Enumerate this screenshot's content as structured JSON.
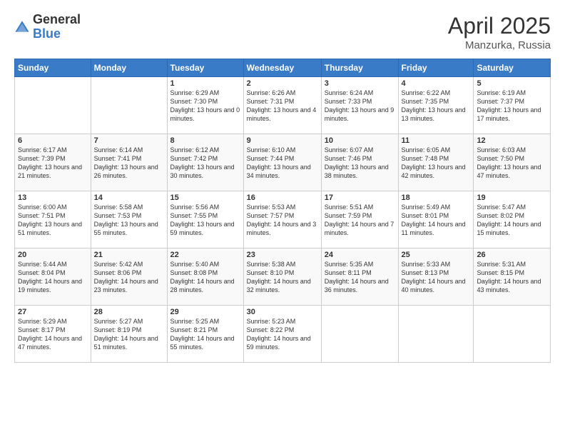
{
  "header": {
    "logo_general": "General",
    "logo_blue": "Blue",
    "title": "April 2025",
    "location": "Manzurka, Russia"
  },
  "days_of_week": [
    "Sunday",
    "Monday",
    "Tuesday",
    "Wednesday",
    "Thursday",
    "Friday",
    "Saturday"
  ],
  "weeks": [
    [
      {
        "day": "",
        "info": ""
      },
      {
        "day": "",
        "info": ""
      },
      {
        "day": "1",
        "info": "Sunrise: 6:29 AM\nSunset: 7:30 PM\nDaylight: 13 hours and 0 minutes."
      },
      {
        "day": "2",
        "info": "Sunrise: 6:26 AM\nSunset: 7:31 PM\nDaylight: 13 hours and 4 minutes."
      },
      {
        "day": "3",
        "info": "Sunrise: 6:24 AM\nSunset: 7:33 PM\nDaylight: 13 hours and 9 minutes."
      },
      {
        "day": "4",
        "info": "Sunrise: 6:22 AM\nSunset: 7:35 PM\nDaylight: 13 hours and 13 minutes."
      },
      {
        "day": "5",
        "info": "Sunrise: 6:19 AM\nSunset: 7:37 PM\nDaylight: 13 hours and 17 minutes."
      }
    ],
    [
      {
        "day": "6",
        "info": "Sunrise: 6:17 AM\nSunset: 7:39 PM\nDaylight: 13 hours and 21 minutes."
      },
      {
        "day": "7",
        "info": "Sunrise: 6:14 AM\nSunset: 7:41 PM\nDaylight: 13 hours and 26 minutes."
      },
      {
        "day": "8",
        "info": "Sunrise: 6:12 AM\nSunset: 7:42 PM\nDaylight: 13 hours and 30 minutes."
      },
      {
        "day": "9",
        "info": "Sunrise: 6:10 AM\nSunset: 7:44 PM\nDaylight: 13 hours and 34 minutes."
      },
      {
        "day": "10",
        "info": "Sunrise: 6:07 AM\nSunset: 7:46 PM\nDaylight: 13 hours and 38 minutes."
      },
      {
        "day": "11",
        "info": "Sunrise: 6:05 AM\nSunset: 7:48 PM\nDaylight: 13 hours and 42 minutes."
      },
      {
        "day": "12",
        "info": "Sunrise: 6:03 AM\nSunset: 7:50 PM\nDaylight: 13 hours and 47 minutes."
      }
    ],
    [
      {
        "day": "13",
        "info": "Sunrise: 6:00 AM\nSunset: 7:51 PM\nDaylight: 13 hours and 51 minutes."
      },
      {
        "day": "14",
        "info": "Sunrise: 5:58 AM\nSunset: 7:53 PM\nDaylight: 13 hours and 55 minutes."
      },
      {
        "day": "15",
        "info": "Sunrise: 5:56 AM\nSunset: 7:55 PM\nDaylight: 13 hours and 59 minutes."
      },
      {
        "day": "16",
        "info": "Sunrise: 5:53 AM\nSunset: 7:57 PM\nDaylight: 14 hours and 3 minutes."
      },
      {
        "day": "17",
        "info": "Sunrise: 5:51 AM\nSunset: 7:59 PM\nDaylight: 14 hours and 7 minutes."
      },
      {
        "day": "18",
        "info": "Sunrise: 5:49 AM\nSunset: 8:01 PM\nDaylight: 14 hours and 11 minutes."
      },
      {
        "day": "19",
        "info": "Sunrise: 5:47 AM\nSunset: 8:02 PM\nDaylight: 14 hours and 15 minutes."
      }
    ],
    [
      {
        "day": "20",
        "info": "Sunrise: 5:44 AM\nSunset: 8:04 PM\nDaylight: 14 hours and 19 minutes."
      },
      {
        "day": "21",
        "info": "Sunrise: 5:42 AM\nSunset: 8:06 PM\nDaylight: 14 hours and 23 minutes."
      },
      {
        "day": "22",
        "info": "Sunrise: 5:40 AM\nSunset: 8:08 PM\nDaylight: 14 hours and 28 minutes."
      },
      {
        "day": "23",
        "info": "Sunrise: 5:38 AM\nSunset: 8:10 PM\nDaylight: 14 hours and 32 minutes."
      },
      {
        "day": "24",
        "info": "Sunrise: 5:35 AM\nSunset: 8:11 PM\nDaylight: 14 hours and 36 minutes."
      },
      {
        "day": "25",
        "info": "Sunrise: 5:33 AM\nSunset: 8:13 PM\nDaylight: 14 hours and 40 minutes."
      },
      {
        "day": "26",
        "info": "Sunrise: 5:31 AM\nSunset: 8:15 PM\nDaylight: 14 hours and 43 minutes."
      }
    ],
    [
      {
        "day": "27",
        "info": "Sunrise: 5:29 AM\nSunset: 8:17 PM\nDaylight: 14 hours and 47 minutes."
      },
      {
        "day": "28",
        "info": "Sunrise: 5:27 AM\nSunset: 8:19 PM\nDaylight: 14 hours and 51 minutes."
      },
      {
        "day": "29",
        "info": "Sunrise: 5:25 AM\nSunset: 8:21 PM\nDaylight: 14 hours and 55 minutes."
      },
      {
        "day": "30",
        "info": "Sunrise: 5:23 AM\nSunset: 8:22 PM\nDaylight: 14 hours and 59 minutes."
      },
      {
        "day": "",
        "info": ""
      },
      {
        "day": "",
        "info": ""
      },
      {
        "day": "",
        "info": ""
      }
    ]
  ]
}
